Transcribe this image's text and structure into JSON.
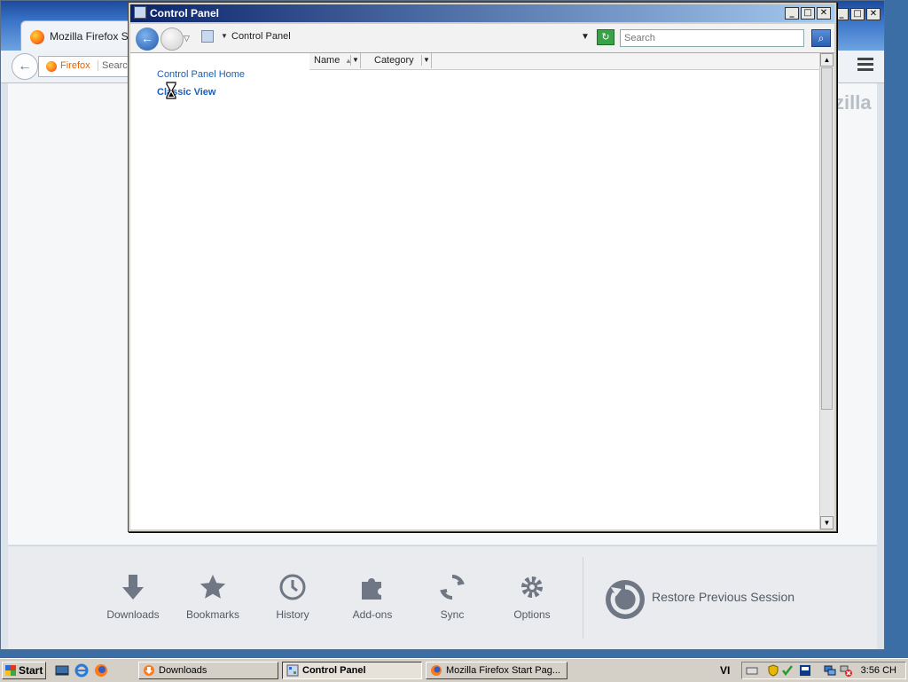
{
  "firefox": {
    "tab_title": "Mozilla Firefox Star",
    "url_label": "Firefox",
    "search_placeholder": "Search",
    "watermark": "zilla",
    "launcher": [
      {
        "label": "Downloads",
        "icon": "download-icon"
      },
      {
        "label": "Bookmarks",
        "icon": "star-icon"
      },
      {
        "label": "History",
        "icon": "clock-icon"
      },
      {
        "label": "Add-ons",
        "icon": "puzzle-icon"
      },
      {
        "label": "Sync",
        "icon": "sync-icon"
      },
      {
        "label": "Options",
        "icon": "gear-icon"
      }
    ],
    "restore_label": "Restore Previous Session"
  },
  "control_panel": {
    "title": "Control Panel",
    "address": "Control Panel",
    "search_placeholder": "Search",
    "links": {
      "home": "Control Panel Home",
      "classic": "Classic View"
    },
    "columns": [
      "Name",
      "Category"
    ]
  },
  "taskbar": {
    "start_label": "Start",
    "tasks": [
      {
        "label": "Downloads",
        "active": false
      },
      {
        "label": "Control Panel",
        "active": true
      },
      {
        "label": "Mozilla Firefox Start Pag...",
        "active": false
      }
    ],
    "language": "VI",
    "clock": "3:56 CH"
  },
  "colors": {
    "desktop": "#3a6ea5",
    "cp_titlebar_start": "#0a246a",
    "link": "#1c5fb8",
    "firefox_accent": "#e66000"
  }
}
